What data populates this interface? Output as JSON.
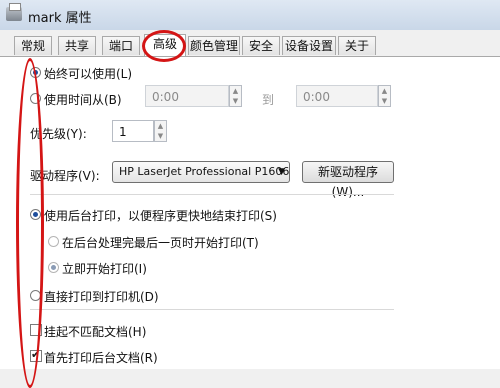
{
  "window": {
    "title": "mark 属性"
  },
  "tabs": [
    {
      "label": "常规"
    },
    {
      "label": "共享"
    },
    {
      "label": "端口"
    },
    {
      "label": "高级"
    },
    {
      "label": "颜色管理"
    },
    {
      "label": "安全"
    },
    {
      "label": "设备设置"
    },
    {
      "label": "关于"
    }
  ],
  "availability": {
    "always_label": "始终可以使用(L)",
    "from_label": "使用时间从(B)",
    "from_time": "0:00",
    "to_label": "到",
    "to_time": "0:00"
  },
  "priority": {
    "label": "优先级(Y):",
    "value": "1"
  },
  "driver": {
    "label": "驱动程序(V):",
    "selected": "HP LaserJet Professional P1606",
    "new_button": "新驱动程序(W)..."
  },
  "spool": {
    "use_spool_label": "使用后台打印，以便程序更快地结束打印(S)",
    "after_last_page_label": "在后台处理完最后一页时开始打印(T)",
    "immediately_label": "立即开始打印(I)",
    "direct_label": "直接打印到打印机(D)"
  },
  "options": {
    "hold_mismatched_label": "挂起不匹配文档(H)",
    "hold_mismatched_checked": false,
    "spooled_first_label": "首先打印后台文档(R)",
    "spooled_first_checked": true
  }
}
